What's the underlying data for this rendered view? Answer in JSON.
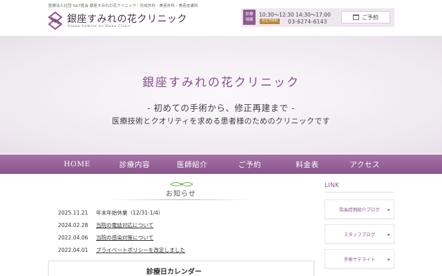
{
  "header": {
    "tagline": "医療法人社団 S&T医会 銀座すみれの花クリニック｜形成外科・美容外科・美容皮膚科",
    "logo_title": "銀座すみれの花クリニック",
    "logo_subtitle": "Ginza Sumire no Hana Clinic",
    "hours_badge_line1": "診療",
    "hours_badge_line2": "時間",
    "hours": "10:30～12:30  14:30～17:00",
    "hours_tag": "完全予約制",
    "phone": "03-6274-6143",
    "reserve_label": "ご予約"
  },
  "hero": {
    "title": "銀座すみれの花クリニック",
    "line1": "- 初めての手術から、修正再建まで -",
    "line2": "医療技術とクオリティを求める患者様のためのクリニックです"
  },
  "nav": [
    {
      "label": "HOME"
    },
    {
      "label": "診療内容"
    },
    {
      "label": "医師紹介"
    },
    {
      "label": "ご予約"
    },
    {
      "label": "料金表"
    },
    {
      "label": "アクセス"
    }
  ],
  "news": {
    "heading": "お知らせ",
    "items": [
      {
        "date": "2025.11.21",
        "text": "年末年始休業（12/31-1/4）",
        "link": false
      },
      {
        "date": "2024.02.28",
        "text": "当院の電話対応について",
        "link": true
      },
      {
        "date": "2022.04.06",
        "text": "当院の感染対策について",
        "link": true
      },
      {
        "date": "2022.04.01",
        "text": "プライベートポリシーを改定しました",
        "link": true
      }
    ]
  },
  "calendar": {
    "title": "診療日カレンダー"
  },
  "sidebar": {
    "title": "LINK",
    "links": [
      {
        "label": "院長症例紹介ブログ"
      },
      {
        "label": "スタッフブログ"
      },
      {
        "label": "手術サテライト"
      }
    ]
  },
  "colors": {
    "brand": "#8b4f8e",
    "nav_top": "#a574a7",
    "nav_bottom": "#8a538c",
    "accent_gold": "#b58a3c"
  }
}
